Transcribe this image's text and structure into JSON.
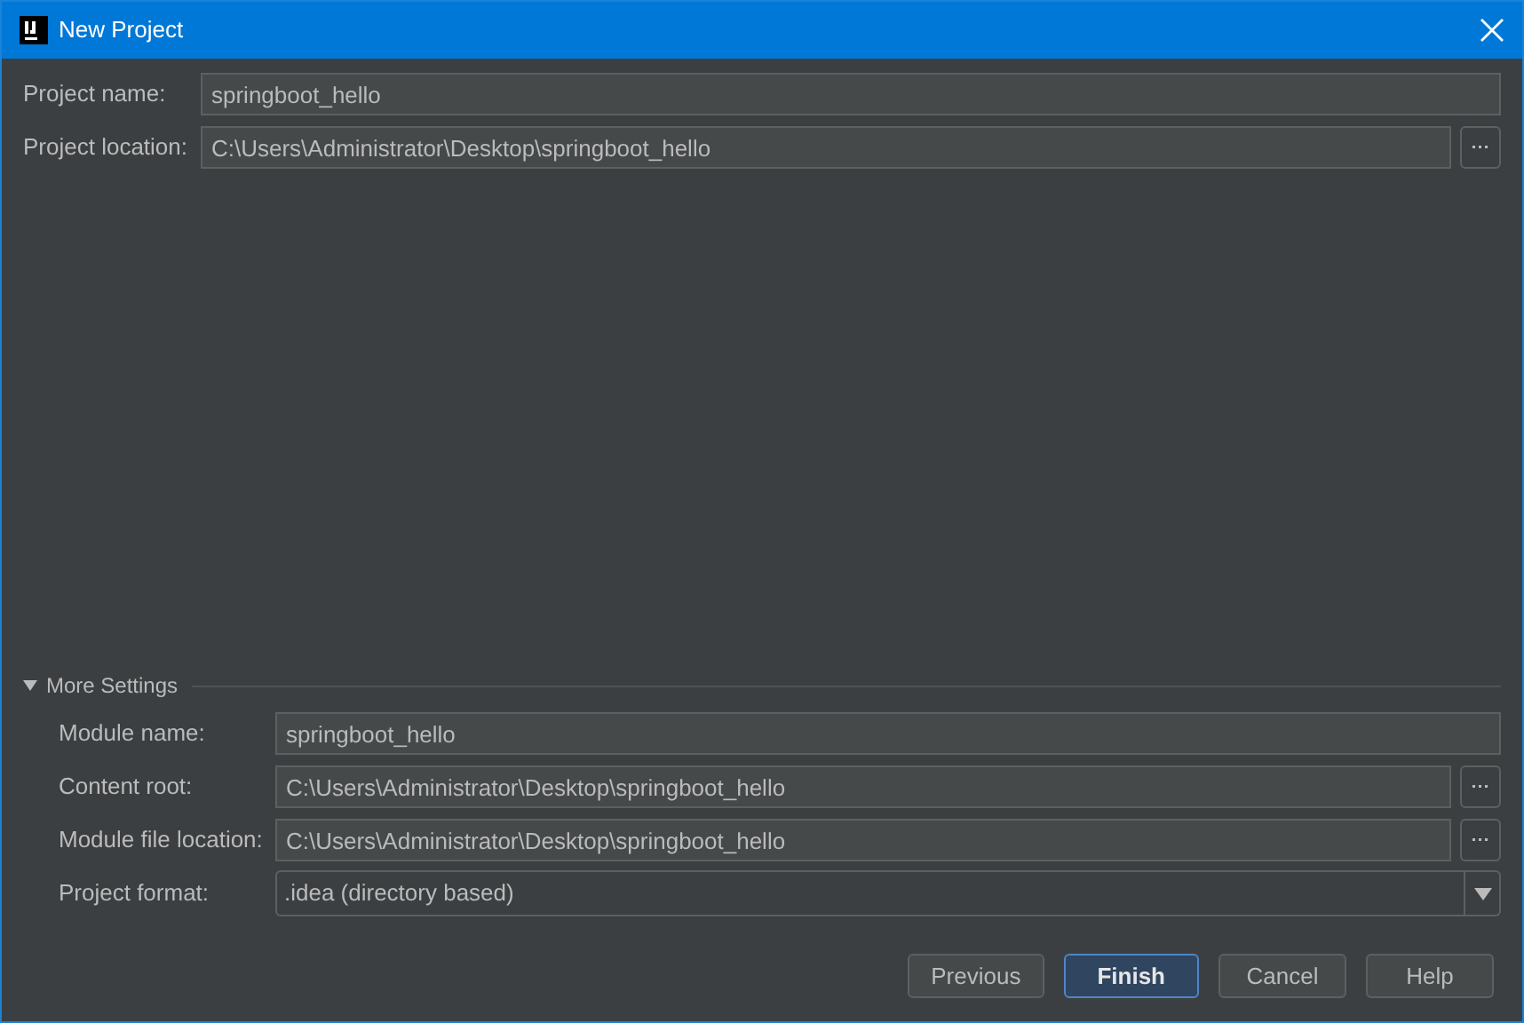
{
  "window": {
    "title": "New Project"
  },
  "project_fields": [
    {
      "label": "Project name:",
      "value": "springboot_hello",
      "browse": false
    },
    {
      "label": "Project location:",
      "value": "C:\\Users\\Administrator\\Desktop\\springboot_hello",
      "browse": true
    }
  ],
  "more_settings": {
    "label": "More Settings",
    "expanded": true,
    "fields": [
      {
        "kind": "text",
        "label": "Module name:",
        "value": "springboot_hello",
        "browse": false
      },
      {
        "kind": "text",
        "label": "Content root:",
        "value": "C:\\Users\\Administrator\\Desktop\\springboot_hello",
        "browse": true
      },
      {
        "kind": "text",
        "label": "Module file location:",
        "value": "C:\\Users\\Administrator\\Desktop\\springboot_hello",
        "browse": true
      },
      {
        "kind": "dropdown",
        "label": "Project format:",
        "value": ".idea (directory based)"
      }
    ]
  },
  "buttons": [
    {
      "label": "Previous",
      "default": false
    },
    {
      "label": "Finish",
      "default": true
    },
    {
      "label": "Cancel",
      "default": false
    },
    {
      "label": "Help",
      "default": false
    }
  ]
}
